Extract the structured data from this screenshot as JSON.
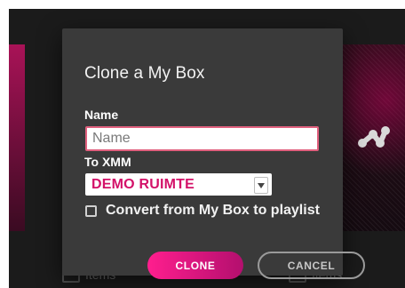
{
  "dialog": {
    "title": "Clone a My Box",
    "name_label": "Name",
    "name_input_placeholder": "Name",
    "name_input_value": "",
    "to_label": "To XMM",
    "to_select_value": "DEMO RUIMTE",
    "checkbox_label": "Convert from My Box to playlist",
    "checkbox_checked": false,
    "buttons": {
      "clone": "CLONE",
      "cancel": "CANCEL"
    }
  },
  "background": {
    "left_count": "Items",
    "right_count": "Items"
  },
  "colors": {
    "accent_pink": "#d31168",
    "dialog_bg": "#3a3a3a",
    "app_bg": "#1b1b1b",
    "cancel_border": "#9a9a9a"
  },
  "icons": {
    "select_arrow": "chevron-down-icon",
    "background_logo": "brand-logo-icon",
    "stack": "stack-icon"
  }
}
